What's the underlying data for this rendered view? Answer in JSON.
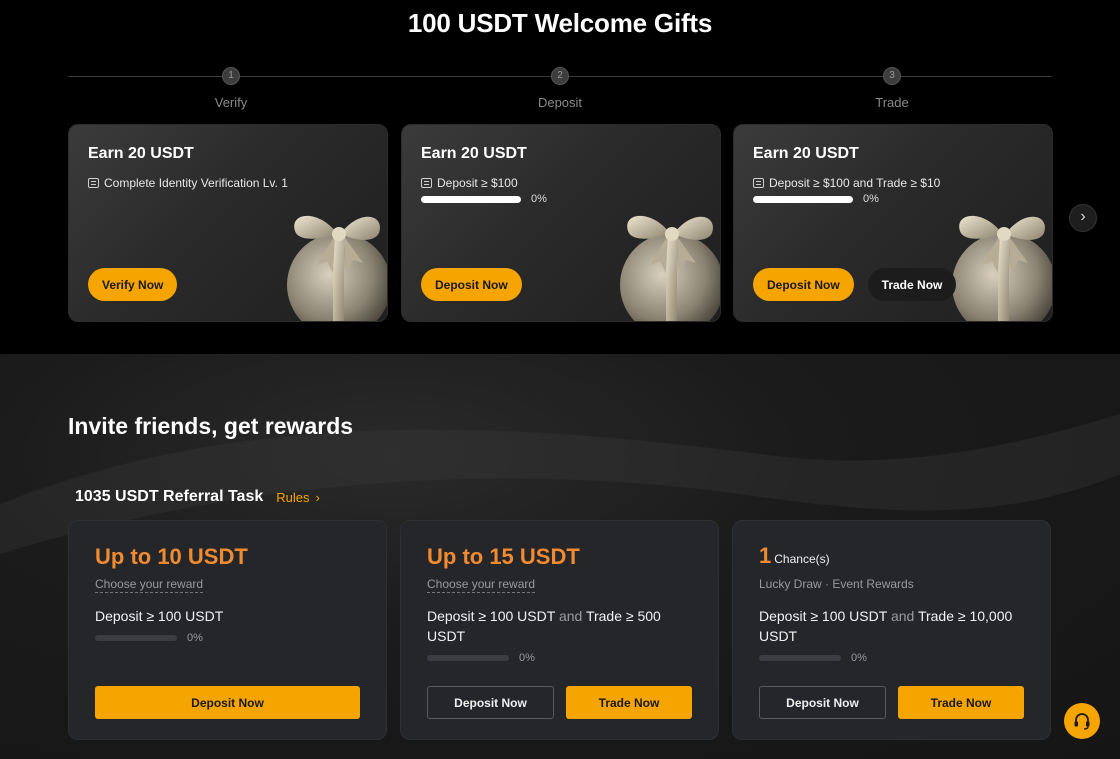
{
  "welcome": {
    "title": "100 USDT Welcome Gifts",
    "steps": [
      {
        "num": "1",
        "label": "Verify"
      },
      {
        "num": "2",
        "label": "Deposit"
      },
      {
        "num": "3",
        "label": "Trade"
      }
    ],
    "cards": [
      {
        "earn": "Earn 20 USDT",
        "task": "Complete Identity Verification Lv. 1",
        "primary": "Verify Now"
      },
      {
        "earn": "Earn 20 USDT",
        "task": "Deposit ≥ $100",
        "progress": "0%",
        "progress_fraction": 0,
        "primary": "Deposit Now"
      },
      {
        "earn": "Earn 20 USDT",
        "task": "Deposit ≥ $100 and Trade ≥ $10",
        "progress": "0%",
        "progress_fraction": 0,
        "primary": "Deposit Now",
        "secondary": "Trade Now"
      }
    ],
    "next_icon": "chevron-right-icon"
  },
  "invite": {
    "title": "Invite friends, get rewards",
    "task_title": "1035 USDT Referral Task",
    "rules_label": "Rules",
    "cards": [
      {
        "amount": "Up to 10 USDT",
        "choose": "Choose your reward",
        "cond": "Deposit ≥ 100 USDT",
        "progress": "0%",
        "primary": "Deposit Now"
      },
      {
        "amount": "Up to 15 USDT",
        "choose": "Choose your reward",
        "cond_a": "Deposit ≥ 100 USDT",
        "cond_and": "and",
        "cond_b": "Trade ≥ 500 USDT",
        "progress": "0%",
        "secondary": "Deposit Now",
        "primary": "Trade Now"
      },
      {
        "chance_num": "1",
        "chance_label": "Chance(s)",
        "sub": "Lucky Draw · Event Rewards",
        "cond_a": "Deposit ≥ 100 USDT",
        "cond_and": "and",
        "cond_b": "Trade ≥ 10,000 USDT",
        "progress": "0%",
        "secondary": "Deposit Now",
        "primary": "Trade Now"
      }
    ]
  },
  "colors": {
    "accent": "#f6a400",
    "amount": "#f28b30"
  },
  "support_icon": "headset-icon"
}
